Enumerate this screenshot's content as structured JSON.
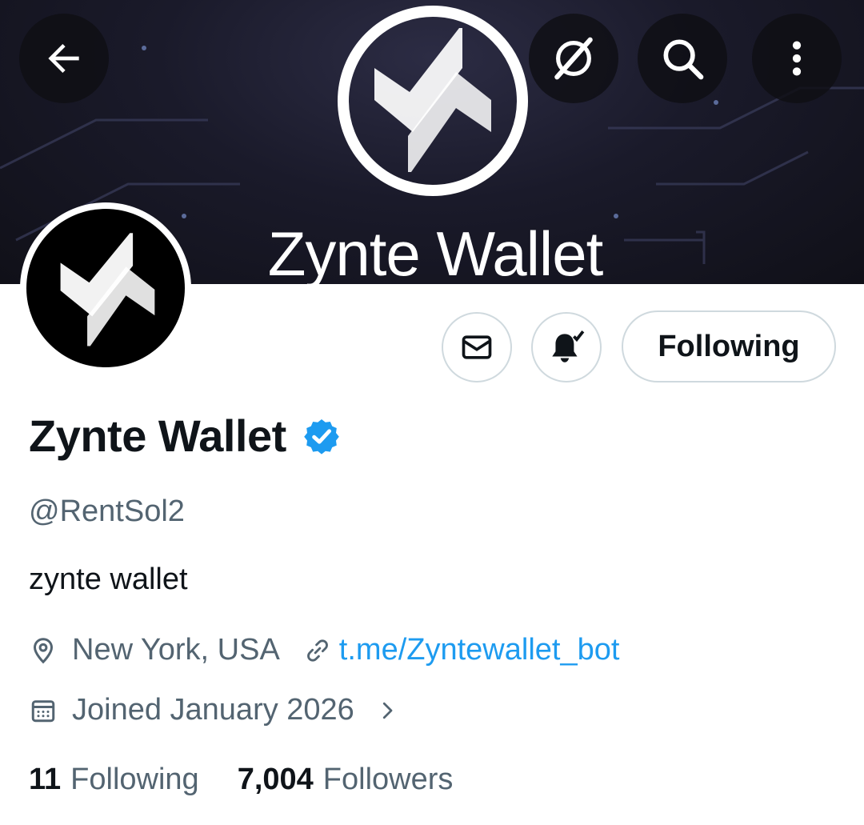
{
  "banner": {
    "title": "Zynte Wallet"
  },
  "profile": {
    "display_name": "Zynte Wallet",
    "handle": "@RentSol2",
    "bio": "zynte wallet",
    "location": "New York, USA",
    "website": "t.me/Zyntewallet_bot",
    "joined": "Joined January 2026",
    "following_count": "11",
    "following_label": "Following",
    "followers_count": "7,004",
    "followers_label": "Followers",
    "verified": true
  },
  "actions": {
    "follow_label": "Following"
  },
  "icons": {
    "back": "arrow-left-icon",
    "grok": "grok-icon",
    "search": "search-icon",
    "more": "more-vertical-icon",
    "message": "envelope-icon",
    "notifications": "bell-check-icon",
    "location": "location-pin-icon",
    "link": "link-icon",
    "calendar": "calendar-icon",
    "chevron": "chevron-right-icon",
    "verified": "verified-badge-icon"
  },
  "colors": {
    "accent": "#1d9bf0",
    "text": "#0f1419",
    "secondary": "#536471",
    "border": "#cfd9de"
  }
}
